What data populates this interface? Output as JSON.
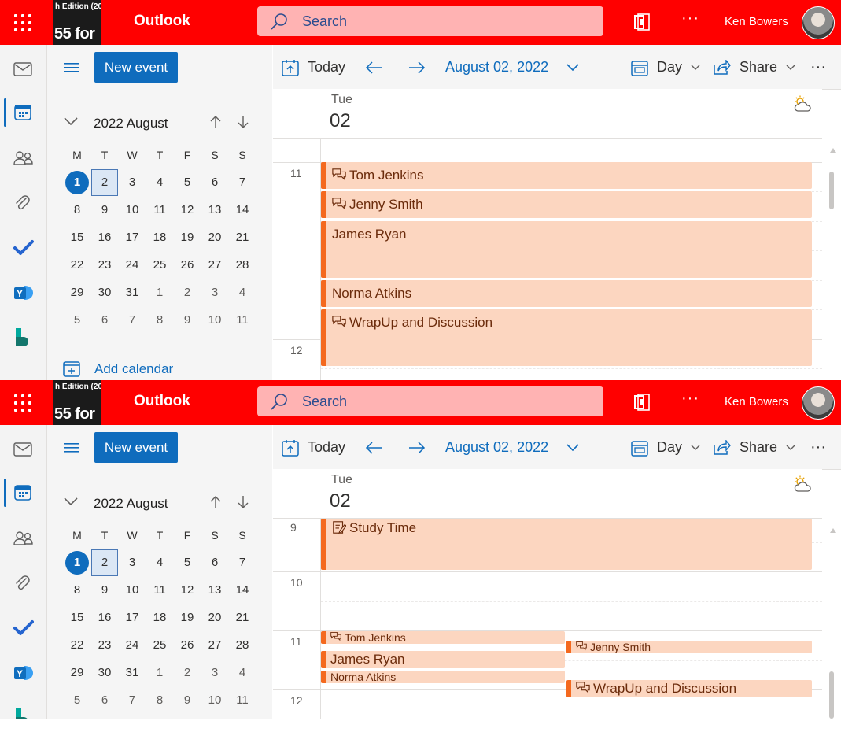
{
  "app": {
    "brand": "Outlook",
    "video_overlay": {
      "line1": "h Edition (20",
      "line2": "55 for"
    },
    "search_placeholder": "Search",
    "more_dots": "···",
    "user_name": "Ken Bowers"
  },
  "icons": {
    "waffle": "app-launcher-icon",
    "search": "search-icon",
    "office": "office-icon",
    "rail": [
      "mail-icon",
      "calendar-icon",
      "people-icon",
      "attachment-icon",
      "todo-icon",
      "yammer-icon",
      "bookings-icon"
    ]
  },
  "colors": {
    "topbar": "#ff0000",
    "accent": "#0f6cbd",
    "event_fill": "#fcd6c0",
    "event_border": "#f4691e"
  },
  "left_pane": {
    "new_event_label": "New event",
    "mini_calendar": {
      "title": "2022 August",
      "weekdays": [
        "M",
        "T",
        "W",
        "T",
        "F",
        "S",
        "S"
      ],
      "weeks": [
        [
          "1",
          "2",
          "3",
          "4",
          "5",
          "6",
          "7"
        ],
        [
          "8",
          "9",
          "10",
          "11",
          "12",
          "13",
          "14"
        ],
        [
          "15",
          "16",
          "17",
          "18",
          "19",
          "20",
          "21"
        ],
        [
          "22",
          "23",
          "24",
          "25",
          "26",
          "27",
          "28"
        ],
        [
          "29",
          "30",
          "31",
          "1",
          "2",
          "3",
          "4"
        ],
        [
          "5",
          "6",
          "7",
          "8",
          "9",
          "10",
          "11"
        ]
      ],
      "today": "1",
      "selected": "2"
    },
    "add_calendar_label": "Add calendar"
  },
  "toolbar": {
    "today_label": "Today",
    "date_label": "August 02, 2022",
    "view_label": "Day",
    "share_label": "Share",
    "more": "···"
  },
  "day_header": {
    "weekday": "Tue",
    "day": "02"
  },
  "panel1": {
    "hour_labels": {
      "h11": "11",
      "h12": "12"
    },
    "events": [
      {
        "title": "Tom Jenkins",
        "icon": "meeting-chat-icon"
      },
      {
        "title": "Jenny Smith",
        "icon": "meeting-chat-icon"
      },
      {
        "title": "James Ryan",
        "icon": ""
      },
      {
        "title": "Norma Atkins",
        "icon": ""
      },
      {
        "title": "WrapUp and Discussion",
        "icon": "meeting-chat-icon"
      }
    ]
  },
  "panel2": {
    "hour_labels": {
      "h9": "9",
      "h10": "10",
      "h11": "11",
      "h12": "12"
    },
    "events": [
      {
        "title": "Study Time",
        "icon": "notes-icon"
      },
      {
        "title": "Tom Jenkins",
        "icon": "meeting-chat-icon"
      },
      {
        "title": "Jenny Smith",
        "icon": "meeting-chat-icon"
      },
      {
        "title": "James Ryan",
        "icon": ""
      },
      {
        "title": "Norma Atkins",
        "icon": ""
      },
      {
        "title": "WrapUp and Discussion",
        "icon": "meeting-chat-icon"
      }
    ]
  }
}
